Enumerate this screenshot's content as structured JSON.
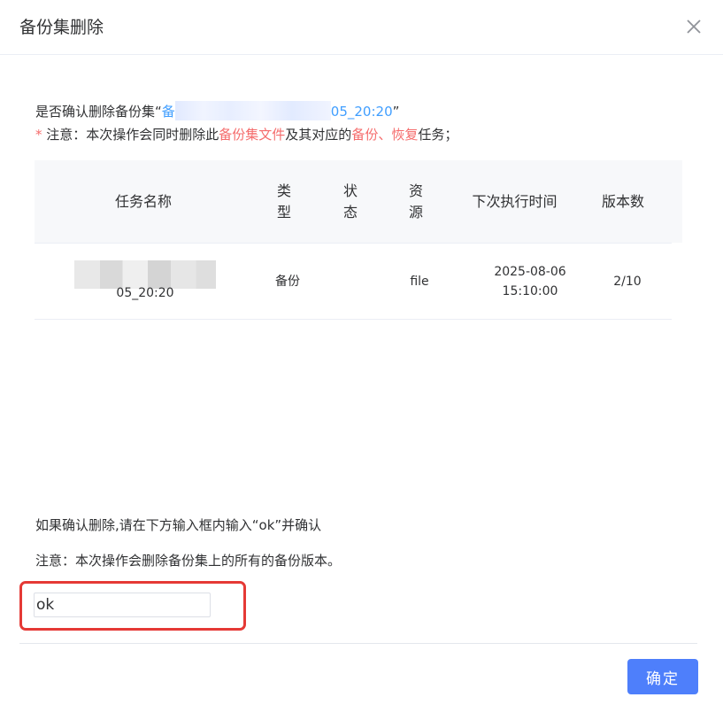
{
  "dialog": {
    "title": "备份集删除"
  },
  "confirm": {
    "prefix": "是否确认删除备份集“",
    "name_head": "备",
    "name_tail": "05_20:20",
    "suffix": "”"
  },
  "notice": {
    "star": "*",
    "part1": " 注意：本次操作会同时删除此",
    "part2": "备份集文件",
    "part3": "及其对应的",
    "part4": "备份、恢复",
    "part5": "任务；"
  },
  "table": {
    "headers": [
      "任务名称",
      "类\n型",
      "状\n态",
      "资\n源",
      "下次执行时间",
      "版本数"
    ],
    "rows": [
      {
        "name_tail": "05_20:20",
        "type": "备份",
        "status": "",
        "resource": "file",
        "next_time": "2025-08-06\n15:10:00",
        "versions": "2/10"
      }
    ]
  },
  "hints": {
    "line1": "如果确认删除,请在下方输入框内输入“ok”并确认",
    "line2": "注意：本次操作会删除备份集上的所有的备份版本。"
  },
  "input": {
    "value": "ok"
  },
  "footer": {
    "confirm_label": "确定"
  },
  "colors": {
    "link": "#409eff",
    "danger": "#f56c6c",
    "primary_button": "#4e7ffb",
    "highlight_box": "#e53935"
  }
}
